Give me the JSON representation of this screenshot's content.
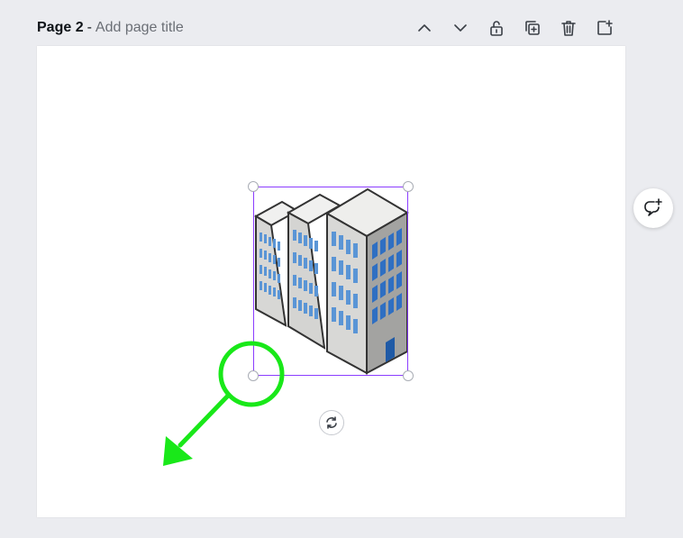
{
  "page_header": {
    "page_label": "Page 2",
    "separator": "-",
    "title_placeholder": "Add page title"
  },
  "toolbar": [
    {
      "name": "move-page-up-button",
      "icon": "chevron-up-icon"
    },
    {
      "name": "move-page-down-button",
      "icon": "chevron-down-icon"
    },
    {
      "name": "lock-page-button",
      "icon": "lock-icon"
    },
    {
      "name": "duplicate-page-button",
      "icon": "duplicate-icon"
    },
    {
      "name": "delete-page-button",
      "icon": "trash-icon"
    },
    {
      "name": "add-page-button",
      "icon": "add-page-icon"
    }
  ],
  "canvas": {
    "element": "isometric-office-buildings-graphic",
    "selected": true
  },
  "side_action": {
    "icon": "add-comment-icon"
  },
  "annotation": {
    "highlight_color": "#19e819",
    "marker": "circle-around-bottom-left-handle",
    "arrow_direction": "down-left"
  },
  "colors": {
    "selection": "#8b3dff",
    "background": "#ebecf0",
    "canvas": "#ffffff"
  }
}
